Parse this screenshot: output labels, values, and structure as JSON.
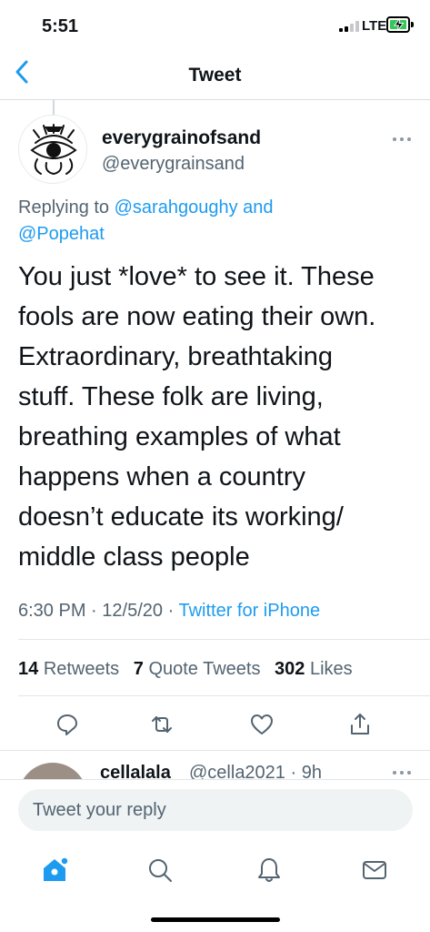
{
  "status_bar": {
    "time": "5:51",
    "network": "LTE"
  },
  "nav": {
    "title": "Tweet"
  },
  "tweet": {
    "display_name": "everygrainofsand",
    "handle": "@everygrainsand",
    "replying_prefix": "Replying to ",
    "replying_to_1": "@sarahgoughy",
    "replying_and": " and",
    "replying_to_2": "@Popehat",
    "text": "You just *love* to see it. These\nfools are now eating their own.\nExtraordinary, breathtaking\nstuff. These folk are living,\nbreathing examples of what\nhappens when a country\ndoesn’t educate its working/\nmiddle class people",
    "time": "6:30 PM",
    "date": "12/5/20",
    "separator": "·",
    "source": "Twitter for iPhone"
  },
  "stats": {
    "retweets_count": "14",
    "retweets_label": "Retweets",
    "quotes_count": "7",
    "quotes_label": "Quote Tweets",
    "likes_count": "302",
    "likes_label": "Likes"
  },
  "actions": {
    "icons": [
      "reply-icon",
      "retweet-icon",
      "like-icon",
      "share-icon"
    ]
  },
  "reply_preview": {
    "name": "cellalala",
    "handle_time": "@cella2021 · 9h"
  },
  "composer": {
    "placeholder": "Tweet your reply"
  },
  "tab_bar": {
    "icons": [
      "home-icon",
      "search-icon",
      "notifications-icon",
      "messages-icon"
    ]
  },
  "colors": {
    "accent": "#1d9bf0",
    "text": "#0f1419",
    "secondary_text": "#536471",
    "battery": "#34c759"
  }
}
